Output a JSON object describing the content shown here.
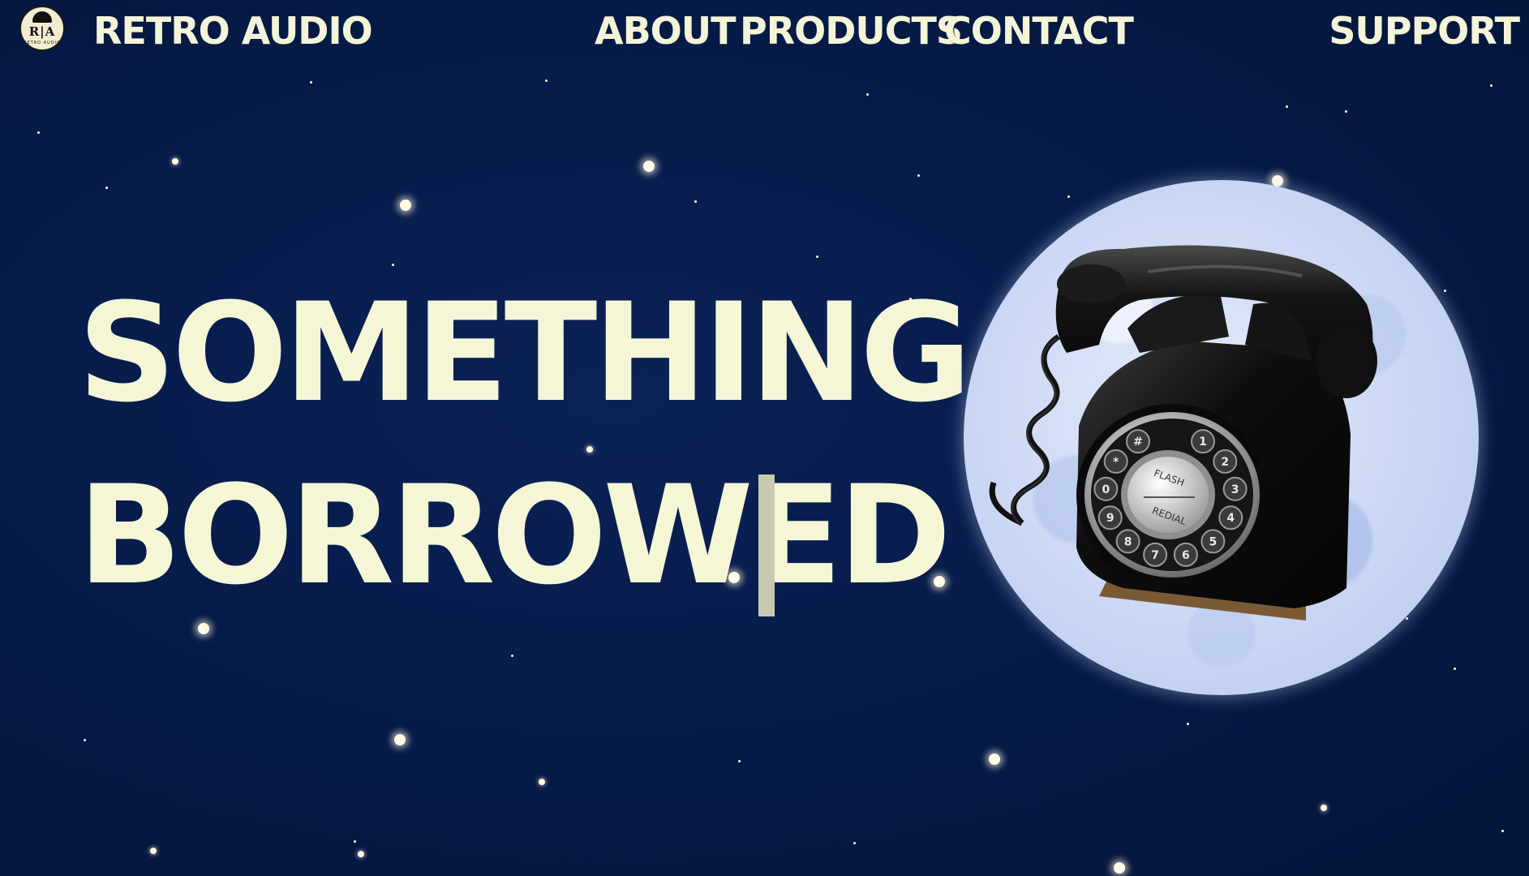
{
  "nav": {
    "logo_letters": "R|A",
    "logo_subtext": "RETRO AUDIO",
    "brand_label": "RETRO AUDIO",
    "links": [
      {
        "label": "ABOUT"
      },
      {
        "label": "PRODUCTS"
      },
      {
        "label": "CONTACT"
      }
    ],
    "support_label": "SUPPORT"
  },
  "hero": {
    "line1": "SOMETHING",
    "line2": "BORROWED"
  },
  "illustration": {
    "moon_icon": "moon-icon",
    "phone_icon": "rotary-telephone-icon",
    "dial_flash_label": "FLASH",
    "dial_redial_label": "REDIAL",
    "dial_keys": [
      "1",
      "2",
      "3",
      "4",
      "5",
      "6",
      "7",
      "8",
      "9",
      "0",
      "*",
      "#"
    ]
  },
  "colors": {
    "background": "#061a47",
    "text": "#f4f6d6",
    "caret": "#c8cab0",
    "moon": "#cad7f4"
  }
}
